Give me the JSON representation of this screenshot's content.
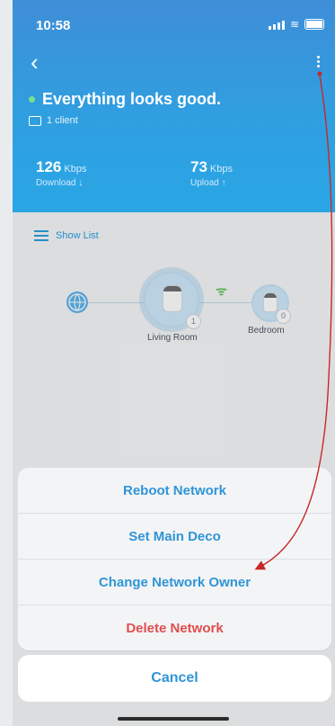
{
  "status_bar": {
    "time": "10:58"
  },
  "header": {
    "status_message": "Everything looks good.",
    "clients_label": "1 client",
    "download": {
      "value": "126",
      "unit": "Kbps",
      "label": "Download ↓"
    },
    "upload": {
      "value": "73",
      "unit": "Kbps",
      "label": "Upload ↑"
    }
  },
  "content": {
    "show_list_label": "Show List",
    "devices": [
      {
        "name": "Living Room",
        "clients": "1"
      },
      {
        "name": "Bedroom",
        "clients": "0"
      }
    ]
  },
  "action_sheet": {
    "items": [
      {
        "label": "Reboot Network"
      },
      {
        "label": "Set Main Deco"
      },
      {
        "label": "Change Network Owner"
      },
      {
        "label": "Delete Network"
      }
    ],
    "cancel_label": "Cancel"
  },
  "colors": {
    "accent": "#2f95d7",
    "danger": "#e24d4d",
    "header_gradient_start": "#3f8ed8",
    "header_gradient_end": "#2aa6e6",
    "status_ok": "#78e08f"
  }
}
